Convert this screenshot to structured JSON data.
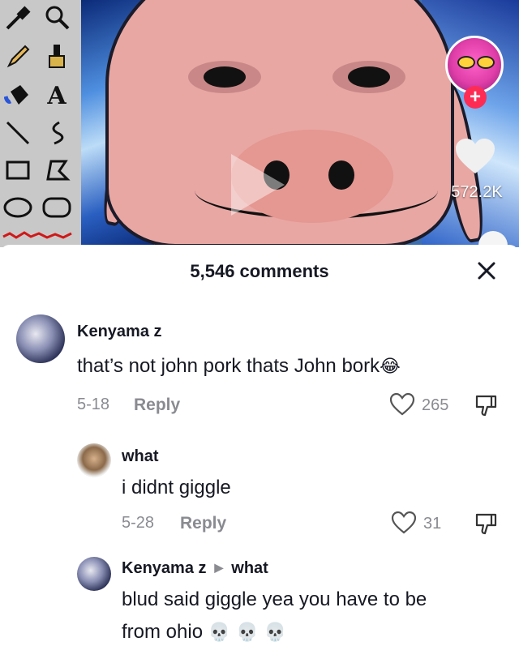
{
  "video": {
    "like_count": "572.2K",
    "follow_symbol": "+"
  },
  "comments_header": {
    "count_label": "5,546 comments",
    "close_symbol": "✕"
  },
  "comments": [
    {
      "author": "Kenyama z",
      "text": "that’s not john pork thats John bork",
      "emoji": "😂",
      "date": "5-18",
      "reply_label": "Reply",
      "likes": "265"
    },
    {
      "author": "what",
      "text": "i didnt giggle",
      "date": "5-28",
      "reply_label": "Reply",
      "likes": "31"
    },
    {
      "author": "Kenyama z",
      "reply_to": "what",
      "text_line1": "blud said giggle yea you have to be",
      "text_line2": "from ohio",
      "emoji": "💀 💀 💀"
    }
  ],
  "colors": {
    "accent": "#fe2c55",
    "text_primary": "#161823",
    "text_secondary": "#8a8b91"
  },
  "icons": [
    "eyedropper-icon",
    "magnifier-icon",
    "pencil-icon",
    "brush-icon",
    "fill-bucket-icon",
    "text-tool-icon",
    "line-icon",
    "curve-icon",
    "rectangle-icon",
    "polygon-icon",
    "ellipse-icon",
    "rounded-rect-icon",
    "play-icon",
    "heart-icon",
    "close-icon",
    "dislike-icon",
    "caret-right-icon"
  ]
}
